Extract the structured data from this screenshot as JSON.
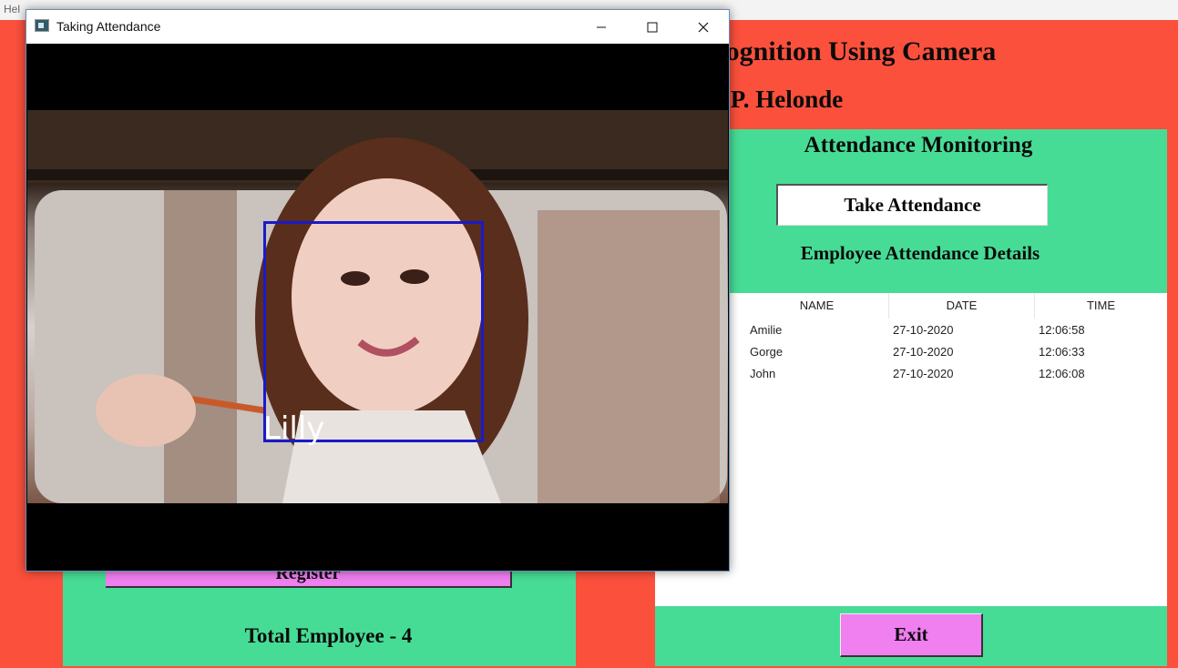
{
  "menu_stub": "Hel",
  "app": {
    "title_partial": "ecognition Using Camera",
    "author_partial": "n P. Helonde"
  },
  "attendance": {
    "heading": "Attendance Monitoring",
    "take_button": "Take Attendance",
    "details_heading": "Employee Attendance Details",
    "columns": [
      "NAME",
      "DATE",
      "TIME"
    ],
    "rows": [
      {
        "name": "Amilie",
        "date": "27-10-2020",
        "time": "12:06:58"
      },
      {
        "name": "Gorge",
        "date": "27-10-2020",
        "time": "12:06:33"
      },
      {
        "name": "John",
        "date": "27-10-2020",
        "time": "12:06:08"
      }
    ],
    "exit_button": "Exit"
  },
  "left": {
    "register_button": "Register",
    "total_label": "Total Employee - 4"
  },
  "camera_window": {
    "title": "Taking Attendance",
    "detected_name": "Lilly",
    "box_color": "#1a1ac8"
  },
  "colors": {
    "background": "#fa503c",
    "panel": "#47dc96",
    "button_pink": "#f07ff0"
  }
}
